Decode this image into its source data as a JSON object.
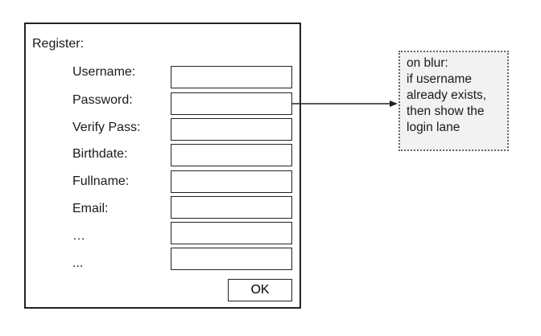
{
  "form": {
    "title": "Register:",
    "fields": [
      {
        "label": "Username:",
        "value": ""
      },
      {
        "label": "Password:",
        "value": ""
      },
      {
        "label": "Verify Pass:",
        "value": ""
      },
      {
        "label": "Birthdate:",
        "value": ""
      },
      {
        "label": "Fullname:",
        "value": ""
      },
      {
        "label": "Email:",
        "value": ""
      },
      {
        "label": "…",
        "value": ""
      },
      {
        "label": "...",
        "value": ""
      }
    ],
    "ok_label": "OK"
  },
  "note": {
    "lines": [
      "on blur:",
      "if username",
      "already exists,",
      "then show the",
      "login lane"
    ]
  }
}
